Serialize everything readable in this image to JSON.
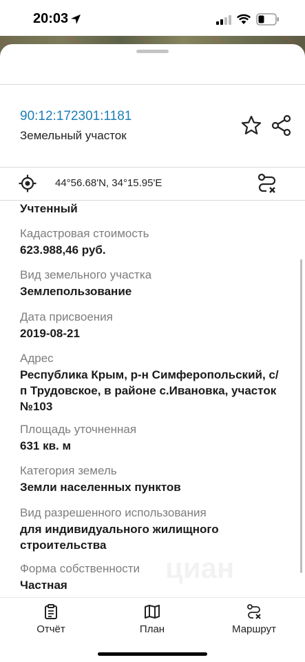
{
  "status_bar": {
    "time": "20:03"
  },
  "header": {
    "cadastral_number": "90:12:172301:1181",
    "object_type": "Земельный участок"
  },
  "location": {
    "coordinates": "44°56.68'N, 34°15.95'E"
  },
  "fields": [
    {
      "label": "",
      "value": "Учтенный"
    },
    {
      "label": "Кадастровая стоимость",
      "value": "623.988,46 руб."
    },
    {
      "label": "Вид земельного участка",
      "value": "Землепользование"
    },
    {
      "label": "Дата присвоения",
      "value": "2019-08-21"
    },
    {
      "label": "Адрес",
      "value": "Республика Крым, р-н Симферопольский, с/п Трудовское, в районе с.Ивановка, участок №103"
    },
    {
      "label": "Площадь уточненная",
      "value": "631 кв. м"
    },
    {
      "label": "Категория земель",
      "value": "Земли населенных пунктов"
    },
    {
      "label": "Вид разрешенного использования",
      "value": "для индивидуального жилищного строительства"
    },
    {
      "label": "Форма собственности",
      "value": "Частная"
    }
  ],
  "watermark": "циан",
  "tabs": [
    {
      "label": "Отчёт",
      "icon": "clipboard-icon"
    },
    {
      "label": "План",
      "icon": "map-icon"
    },
    {
      "label": "Маршрут",
      "icon": "route-icon"
    }
  ],
  "colors": {
    "link": "#1c7fb8",
    "label_gray": "#7d7d7d"
  }
}
